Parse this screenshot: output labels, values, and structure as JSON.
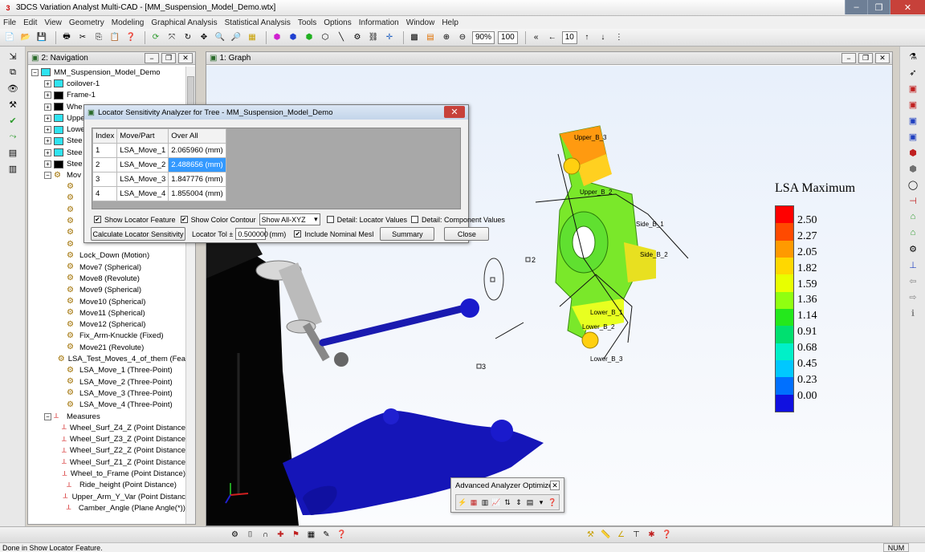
{
  "window": {
    "title": "3DCS Variation Analyst Multi-CAD - [MM_Suspension_Model_Demo.wtx]",
    "controls": [
      "–",
      "❐",
      "✕"
    ]
  },
  "menu": [
    "File",
    "Edit",
    "View",
    "Geometry",
    "Modeling",
    "Graphical Analysis",
    "Statistical Analysis",
    "Tools",
    "Options",
    "Information",
    "Window",
    "Help"
  ],
  "toolbar": {
    "zoom_value": "90%",
    "scale_value": "100",
    "step_value": "10"
  },
  "navigation": {
    "title": "2: Navigation",
    "tree": [
      {
        "label": "MM_Suspension_Model_Demo",
        "exp": "−",
        "icon": "cyan",
        "indent": 0
      },
      {
        "label": "coilover-1",
        "exp": "+",
        "icon": "cyan",
        "indent": 1
      },
      {
        "label": "Frame-1",
        "exp": "+",
        "icon": "black",
        "indent": 1
      },
      {
        "label": "Whe",
        "exp": "+",
        "icon": "black",
        "indent": 1
      },
      {
        "label": "Uppe",
        "exp": "+",
        "icon": "cyan",
        "indent": 1
      },
      {
        "label": "Lowe",
        "exp": "+",
        "icon": "cyan",
        "indent": 1
      },
      {
        "label": "Stee",
        "exp": "+",
        "icon": "cyan",
        "indent": 1
      },
      {
        "label": "Stee",
        "exp": "+",
        "icon": "cyan",
        "indent": 1
      },
      {
        "label": "Stee",
        "exp": "+",
        "icon": "black",
        "indent": 1
      },
      {
        "label": "Mov",
        "exp": "−",
        "icon": "gear",
        "indent": 1
      },
      {
        "label": "",
        "exp": "",
        "icon": "gear",
        "indent": 2
      },
      {
        "label": "",
        "exp": "",
        "icon": "gear",
        "indent": 2
      },
      {
        "label": "",
        "exp": "",
        "icon": "gear",
        "indent": 2
      },
      {
        "label": "",
        "exp": "",
        "icon": "gear",
        "indent": 2
      },
      {
        "label": "",
        "exp": "",
        "icon": "gear",
        "indent": 2
      },
      {
        "label": "",
        "exp": "",
        "icon": "gear",
        "indent": 2
      },
      {
        "label": "Lock_Down (Motion)",
        "exp": "",
        "icon": "gear",
        "indent": 2
      },
      {
        "label": "Move7 (Spherical)",
        "exp": "",
        "icon": "gear",
        "indent": 2
      },
      {
        "label": "Move8 (Revolute)",
        "exp": "",
        "icon": "gear",
        "indent": 2
      },
      {
        "label": "Move9 (Spherical)",
        "exp": "",
        "icon": "gear",
        "indent": 2
      },
      {
        "label": "Move10 (Spherical)",
        "exp": "",
        "icon": "gear",
        "indent": 2
      },
      {
        "label": "Move11 (Spherical)",
        "exp": "",
        "icon": "gear",
        "indent": 2
      },
      {
        "label": "Move12 (Spherical)",
        "exp": "",
        "icon": "gear",
        "indent": 2
      },
      {
        "label": "Fix_Arm-Knuckle (Fixed)",
        "exp": "",
        "icon": "gear",
        "indent": 2
      },
      {
        "label": "Move21 (Revolute)",
        "exp": "",
        "icon": "gear",
        "indent": 2
      },
      {
        "label": "LSA_Test_Moves_4_of_them (Fea",
        "exp": "",
        "icon": "gear",
        "indent": 2
      },
      {
        "label": "LSA_Move_1 (Three-Point)",
        "exp": "",
        "icon": "gear",
        "indent": 2
      },
      {
        "label": "LSA_Move_2 (Three-Point)",
        "exp": "",
        "icon": "gear",
        "indent": 2
      },
      {
        "label": "LSA_Move_3 (Three-Point)",
        "exp": "",
        "icon": "gear",
        "indent": 2
      },
      {
        "label": "LSA_Move_4 (Three-Point)",
        "exp": "",
        "icon": "gear",
        "indent": 2
      },
      {
        "label": "Measures",
        "exp": "−",
        "icon": "meas",
        "indent": 1
      },
      {
        "label": "Wheel_Surf_Z4_Z (Point Distance",
        "exp": "",
        "icon": "meas",
        "indent": 2
      },
      {
        "label": "Wheel_Surf_Z3_Z (Point Distance",
        "exp": "",
        "icon": "meas",
        "indent": 2
      },
      {
        "label": "Wheel_Surf_Z2_Z (Point Distance",
        "exp": "",
        "icon": "meas",
        "indent": 2
      },
      {
        "label": "Wheel_Surf_Z1_Z (Point Distance",
        "exp": "",
        "icon": "meas",
        "indent": 2
      },
      {
        "label": "Wheel_to_Frame (Point Distance)",
        "exp": "",
        "icon": "meas",
        "indent": 2
      },
      {
        "label": "Ride_height (Point Distance)",
        "exp": "",
        "icon": "meas",
        "indent": 2
      },
      {
        "label": "Upper_Arm_Y_Var (Point Distanc",
        "exp": "",
        "icon": "meas",
        "indent": 2
      },
      {
        "label": "Camber_Angle (Plane Angle(*))",
        "exp": "",
        "icon": "meas",
        "indent": 2
      }
    ]
  },
  "graph": {
    "title": "1: Graph",
    "labels": {
      "upper_b3": "Upper_B_3",
      "upper_b2": "Upper_B_2",
      "side_b1": "Side_B_1",
      "side_b2": "Side_B_2",
      "lower_b1": "Lower_B_1",
      "lower_b2": "Lower_B_2",
      "lower_b3": "Lower_B_3",
      "p2": "2",
      "p3": "3"
    },
    "legend": {
      "title": "LSA Maximum",
      "values": [
        "2.50",
        "2.27",
        "2.05",
        "1.82",
        "1.59",
        "1.36",
        "1.14",
        "0.91",
        "0.68",
        "0.45",
        "0.23",
        "0.00"
      ],
      "colors": [
        "#ff0000",
        "#ff4a00",
        "#ff9a00",
        "#ffd800",
        "#e8ff00",
        "#90ff10",
        "#24e81c",
        "#00e070",
        "#00f0c8",
        "#00c8ff",
        "#0070ff",
        "#1010e0"
      ]
    }
  },
  "dialog": {
    "title": "Locator Sensitivity Analyzer for Tree - MM_Suspension_Model_Demo",
    "headers": [
      "Index",
      "Move/Part",
      "Over All"
    ],
    "rows": [
      [
        "1",
        "LSA_Move_1",
        "2.065960 (mm)"
      ],
      [
        "2",
        "LSA_Move_2",
        "2.488656 (mm)"
      ],
      [
        "3",
        "LSA_Move_3",
        "1.847776 (mm)"
      ],
      [
        "4",
        "LSA_Move_4",
        "1.855004 (mm)"
      ]
    ],
    "show_locator_feature": "Show Locator Feature",
    "show_color_contour": "Show Color Contour",
    "show_select": "Show All-XYZ",
    "detail_locator": "Detail: Locator Values",
    "detail_component": "Detail: Component Values",
    "calc_button": "Calculate Locator Sensitivity",
    "locator_tol_label": "Locator Tol ±",
    "locator_tol_value": "0.500000",
    "mm_label": "(mm)",
    "include_nominal": "Include Nominal Mesl",
    "summary_button": "Summary",
    "close_button": "Close"
  },
  "optimizer": {
    "title": "Advanced Analyzer Optimizer"
  },
  "status": {
    "text": "Done in Show Locator Feature.",
    "num": "NUM"
  }
}
